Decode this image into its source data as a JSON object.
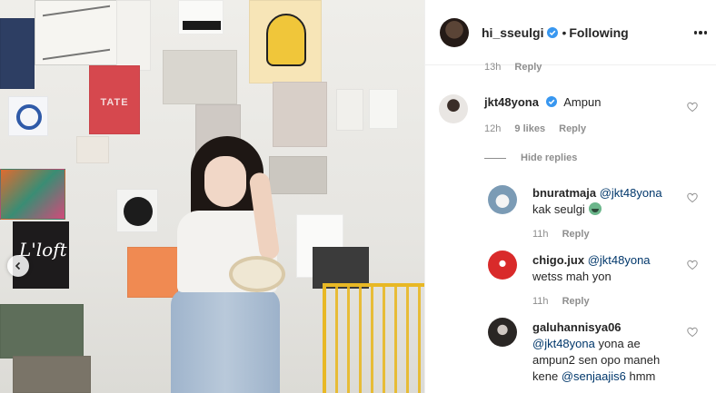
{
  "post": {
    "username": "hi_sseulgi",
    "separator": "•",
    "follow_status": "Following",
    "more_icon": "more-horizontal-icon",
    "verified_color": "#3897f0"
  },
  "photo": {
    "poster_text_tate": "TATE",
    "poster_text_loft": "L'loft"
  },
  "comments_top_meta": {
    "time": "13h",
    "reply_label": "Reply"
  },
  "comment_main": {
    "username": "jkt48yona",
    "text": "Ampun",
    "time": "12h",
    "likes": "9 likes",
    "reply_label": "Reply"
  },
  "hide_replies_label": "Hide replies",
  "replies": [
    {
      "username": "bnuratmaja",
      "mention": "@jkt48yona",
      "text": "kak seulgi",
      "time": "11h",
      "reply_label": "Reply"
    },
    {
      "username": "chigo.jux",
      "mention": "@jkt48yona",
      "text": "wetss mah yon",
      "time": "11h",
      "reply_label": "Reply"
    },
    {
      "username": "galuhannisya06",
      "mention": "@jkt48yona",
      "text_line1": "yona ae",
      "text_line2": "ampun2 sen opo maneh",
      "text_line3_prefix": "kene",
      "mention2": "@senjaajis6",
      "text_line3_suffix": "hmm"
    }
  ],
  "colors": {
    "text": "#262626",
    "meta": "#8e8e8e",
    "mention": "#00376b",
    "border": "#efefef"
  }
}
